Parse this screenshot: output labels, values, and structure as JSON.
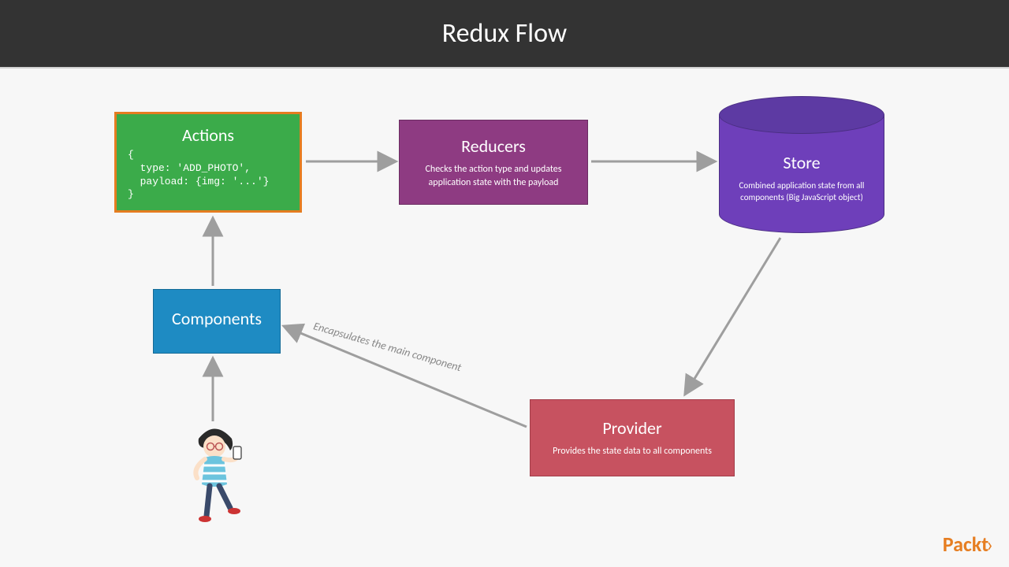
{
  "header": {
    "title": "Redux Flow"
  },
  "nodes": {
    "actions": {
      "title": "Actions",
      "code": "{\n  type: 'ADD_PHOTO',\n  payload: {img: '...'}\n}"
    },
    "reducers": {
      "title": "Reducers",
      "sub": "Checks the action type and updates application state with the payload"
    },
    "store": {
      "title": "Store",
      "sub": "Combined application state from all components\n(Big JavaScript object)"
    },
    "components": {
      "title": "Components"
    },
    "provider": {
      "title": "Provider",
      "sub": "Provides the state data to all components"
    }
  },
  "edges": {
    "providerToComponents": {
      "label": "Encapsulates the main component"
    }
  },
  "logo": {
    "text": "Packt",
    "suffix": "›"
  }
}
